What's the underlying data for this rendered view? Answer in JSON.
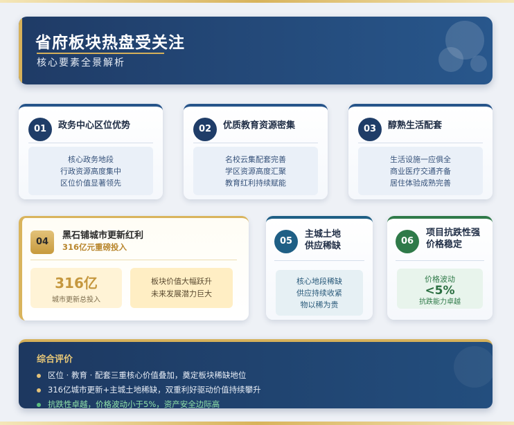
{
  "header": {
    "title": "省府板块热盘受关注",
    "subtitle": "核心要素全景解析"
  },
  "cards": [
    {
      "num": "01",
      "title": "政务中心区位优势",
      "lines": [
        "核心政务地段",
        "行政资源高度集中",
        "区位价值显著领先"
      ]
    },
    {
      "num": "02",
      "title": "优质教育资源密集",
      "lines": [
        "名校云集配套完善",
        "学区资源高度汇聚",
        "教育红利持续赋能"
      ]
    },
    {
      "num": "03",
      "title": "醇熟生活配套",
      "lines": [
        "生活设施一应俱全",
        "商业医疗交通齐备",
        "居住体验成熟完善"
      ]
    }
  ],
  "card4": {
    "num": "04",
    "title": "黑石铺城市更新红利",
    "subtitle": "316亿元重磅投入",
    "big_value": "316亿",
    "big_caption": "城市更新总投入",
    "right_lines": [
      "板块价值大幅跃升",
      "未来发展潜力巨大"
    ]
  },
  "card5": {
    "num": "05",
    "title_lines": [
      "主城土地",
      "供应稀缺"
    ],
    "lines": [
      "核心地段稀缺",
      "供应持续收紧",
      "物以稀为贵"
    ]
  },
  "card6": {
    "num": "06",
    "title_lines": [
      "项目抗跌性强",
      "价格稳定"
    ],
    "label": "价格波动",
    "value": "<5%",
    "caption": "抗跌能力卓越"
  },
  "summary": {
    "title": "综合评价",
    "items": [
      "区位 · 教育 · 配套三重核心价值叠加，奠定板块稀缺地位",
      "316亿城市更新+主城土地稀缺，双重利好驱动价值持续攀升",
      "抗跌性卓越，价格波动小于5%，资产安全边际高"
    ]
  },
  "colors": {
    "navy": "#1f3b66",
    "gold": "#d6b15a",
    "green": "#2f7a49"
  }
}
